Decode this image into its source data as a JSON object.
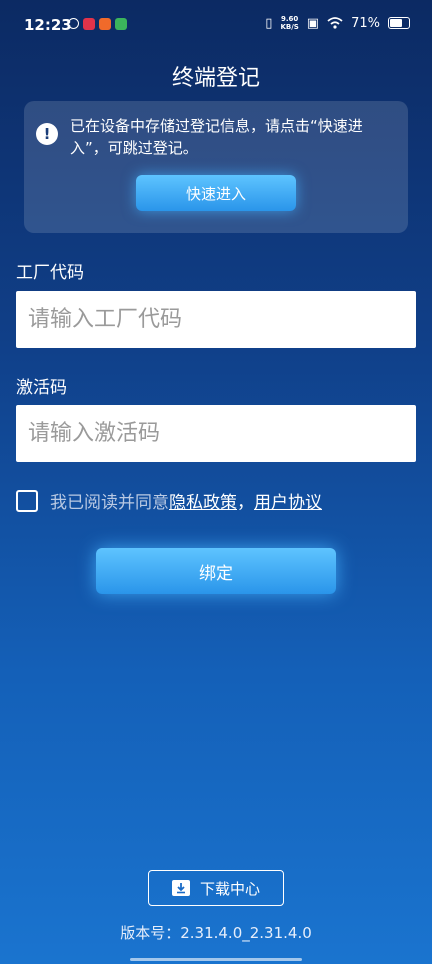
{
  "status_bar": {
    "time": "12:23",
    "net_speed_value": "9.60",
    "net_speed_unit": "KB/S",
    "battery": "71%",
    "battery_level": 0.71
  },
  "page": {
    "title": "终端登记"
  },
  "notice": {
    "text": "已在设备中存储过登记信息，请点击“快速进入”，可跳过登记。",
    "button_label": "快速进入"
  },
  "factory_code": {
    "label": "工厂代码",
    "placeholder": "请输入工厂代码",
    "value": ""
  },
  "activation_code": {
    "label": "激活码",
    "placeholder": "请输入激活码",
    "value": ""
  },
  "agreement": {
    "prefix": "我已阅读并同意",
    "privacy_link": "隐私政策",
    "separator": "，",
    "user_link": "用户协议"
  },
  "bind_button": {
    "label": "绑定"
  },
  "download": {
    "label": "下载中心"
  },
  "version": {
    "text": "版本号：2.31.4.0_2.31.4.0"
  },
  "colors": {
    "accent": "#2a95ea",
    "bg_top": "#0c2a63",
    "bg_bottom": "#1a74cf"
  }
}
